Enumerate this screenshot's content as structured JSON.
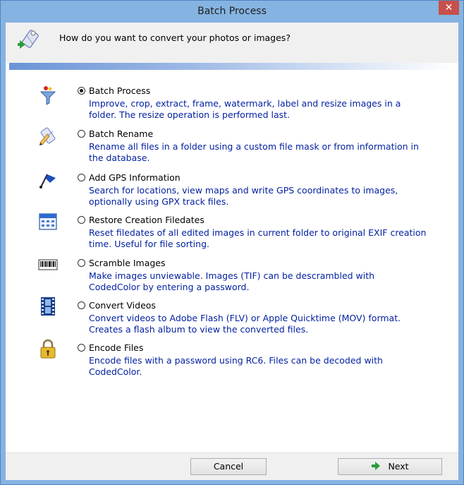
{
  "window": {
    "title": "Batch Process",
    "close_glyph": "✕"
  },
  "header": {
    "icon": "wizard-icon",
    "question": "How do you want to convert your photos or images?"
  },
  "options": [
    {
      "label": "Batch Process",
      "description": "Improve, crop, extract, frame, watermark, label and resize images in a folder. The resize operation is performed last.",
      "icon": "funnel-icon",
      "selected": true
    },
    {
      "label": "Batch Rename",
      "description": "Rename all files in a folder using a custom file mask or from information in the database.",
      "icon": "rename-icon",
      "selected": false
    },
    {
      "label": "Add GPS Information",
      "description": "Search for locations, view maps and write GPS coordinates to images, optionally using GPX track files.",
      "icon": "gps-flag-icon",
      "selected": false
    },
    {
      "label": "Restore Creation Filedates",
      "description": "Reset filedates of all edited images in current folder to original EXIF creation time. Useful for file sorting.",
      "icon": "calendar-icon",
      "selected": false
    },
    {
      "label": "Scramble Images",
      "description": "Make images unviewable. Images (TIF) can be descrambled with CodedColor by entering a password.",
      "icon": "barcode-icon",
      "selected": false
    },
    {
      "label": "Convert Videos",
      "description": "Convert videos to Adobe Flash (FLV) or Apple Quicktime (MOV) format. Creates a flash album to view the converted files.",
      "icon": "film-icon",
      "selected": false
    },
    {
      "label": "Encode Files",
      "description": "Encode files with a password using RC6. Files can be decoded with CodedColor.",
      "icon": "padlock-icon",
      "selected": false
    }
  ],
  "footer": {
    "cancel_label": "Cancel",
    "next_label": "Next",
    "next_icon": "arrow-right-icon"
  },
  "colors": {
    "title_bar": "#85b3e2",
    "close_button": "#c7504a",
    "description_text": "#001fa0",
    "next_arrow": "#2a9d3a"
  }
}
